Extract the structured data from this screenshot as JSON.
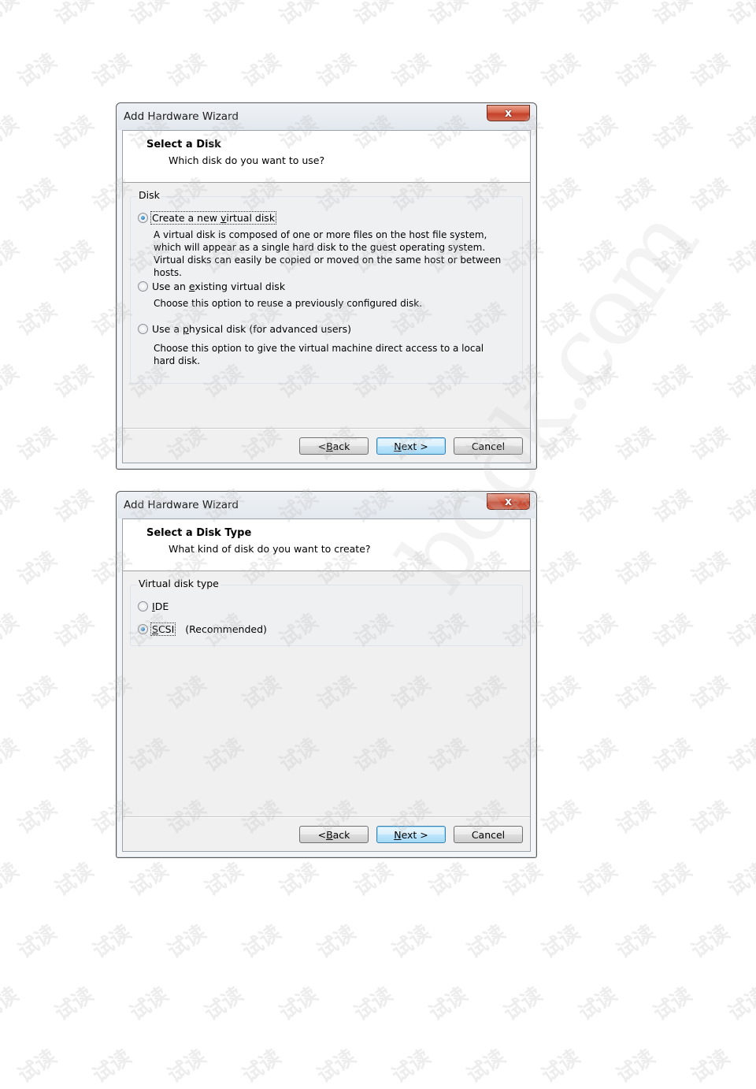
{
  "watermark": {
    "text": "试读",
    "big_text": "book.com"
  },
  "dialogs": [
    {
      "title": "Add Hardware Wizard",
      "close_glyph": "x",
      "header_title": "Select a Disk",
      "header_subtitle": "Which disk do you want to use?",
      "group_label": "Disk",
      "options": [
        {
          "label_pre": "Create a new ",
          "label_mnemonic": "v",
          "label_post": "irtual disk",
          "checked": true,
          "description": "A virtual disk is composed of one or more files on the host file system, which will appear as a single hard disk to the guest operating system. Virtual disks can easily be copied or moved on the same host or between hosts."
        },
        {
          "label_pre": "Use an ",
          "label_mnemonic": "e",
          "label_post": "xisting virtual disk",
          "checked": false,
          "description": "Choose this option to reuse a previously configured disk."
        },
        {
          "label_pre": "Use a ",
          "label_mnemonic": "p",
          "label_post": "hysical disk (for advanced users)",
          "checked": false,
          "description": "Choose this option to give the virtual machine direct access to a local hard disk."
        }
      ],
      "buttons": {
        "back": {
          "pre": "< ",
          "mnemonic": "B",
          "post": "ack"
        },
        "next": {
          "pre": "",
          "mnemonic": "N",
          "post": "ext >"
        },
        "cancel": "Cancel"
      }
    },
    {
      "title": "Add Hardware Wizard",
      "close_glyph": "x",
      "header_title": "Select a Disk Type",
      "header_subtitle": "What kind of disk do you want to create?",
      "group_label": "Virtual disk type",
      "options": [
        {
          "label_pre": "",
          "label_mnemonic": "I",
          "label_post": "DE",
          "suffix": "",
          "checked": false
        },
        {
          "label_pre": "",
          "label_mnemonic": "S",
          "label_post": "CSI",
          "suffix": "(Recommended)",
          "checked": true
        }
      ],
      "buttons": {
        "back": {
          "pre": "< ",
          "mnemonic": "B",
          "post": "ack"
        },
        "next": {
          "pre": "",
          "mnemonic": "N",
          "post": "ext >"
        },
        "cancel": "Cancel"
      }
    }
  ]
}
